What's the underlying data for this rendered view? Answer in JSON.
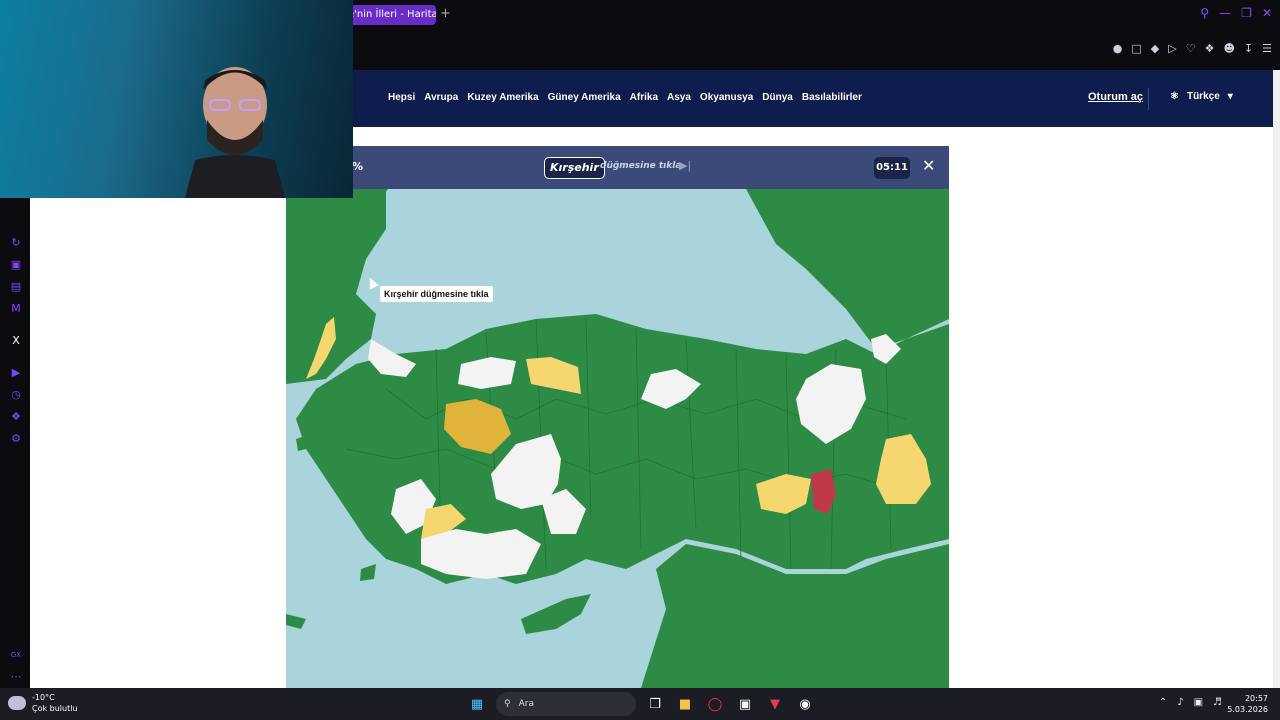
{
  "browser": {
    "tab_title": "e'nin İlleri - Harita Te",
    "new_tab": "+",
    "window_controls": [
      "search-icon",
      "minimize-icon",
      "restore-icon",
      "close-icon"
    ],
    "toolbar_icons": [
      "pin-icon",
      "snapshot-icon",
      "shield-icon",
      "play-icon",
      "heart-icon",
      "extensions-icon",
      "profile-icon",
      "download-icon",
      "menu-icon"
    ]
  },
  "nav": {
    "links": [
      "Hepsi",
      "Avrupa",
      "Kuzey Amerika",
      "Güney Amerika",
      "Afrika",
      "Asya",
      "Okyanusya",
      "Dünya",
      "Basılabilirler"
    ],
    "login": "Oturum aç",
    "language": "Türkçe"
  },
  "game": {
    "progress": "%",
    "target": "Kırşehir",
    "instruction": "düğmesine tıkla",
    "skip_icon": "skip-icon",
    "timer": "05:11",
    "close_icon": "close-icon",
    "tooltip": "Kırşehir düğmesine tıkla",
    "colors": {
      "sea": "#a9d4dc",
      "unanswered": "#2e8b45",
      "correct": "#f3f3f3",
      "second_try": "#f6d66e",
      "third_try": "#e0b43a",
      "wrong": "#c0394a"
    }
  },
  "taskbar": {
    "temperature": "-10°C",
    "weather": "Çok bulutlu",
    "search_label": "Ara",
    "time": "20:57",
    "date": "5.03.2026"
  },
  "sidebar_icons": [
    "refresh-icon",
    "store-icon",
    "wallet-icon",
    "messenger-icon",
    "x-icon",
    "player-icon",
    "history-icon",
    "extensions-icon",
    "settings-icon",
    "gx-icon",
    "more-icon"
  ]
}
